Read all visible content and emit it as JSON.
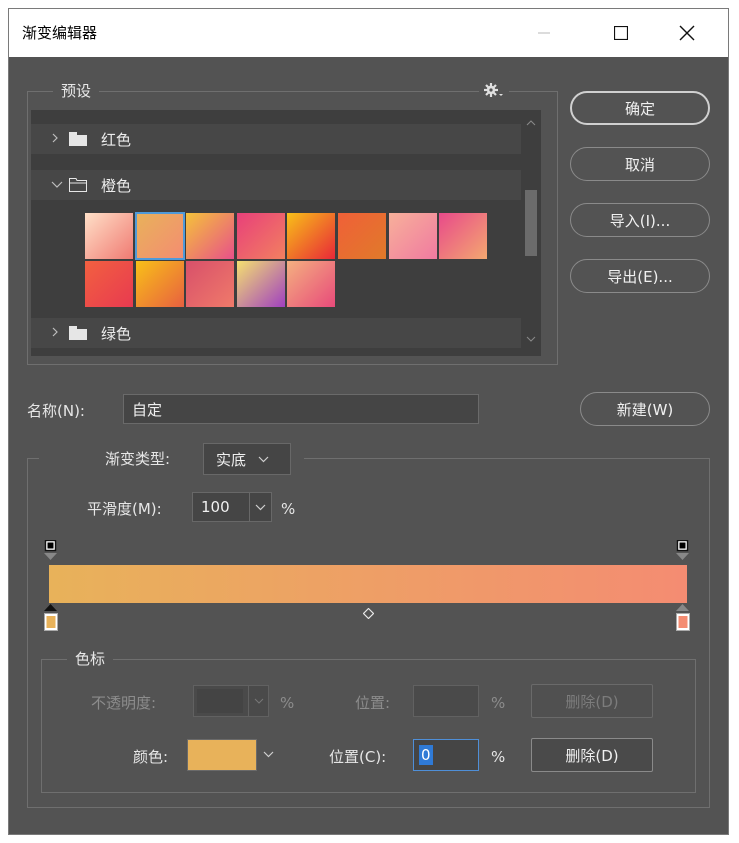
{
  "window": {
    "title": "渐变编辑器"
  },
  "titlebar": {
    "minimize": "—",
    "maximize": "☐",
    "close": "✕"
  },
  "presets": {
    "legend": "预设",
    "folders": [
      {
        "name": "红色",
        "expanded": false
      },
      {
        "name": "橙色",
        "expanded": true
      },
      {
        "name": "绿色",
        "expanded": false
      }
    ],
    "swatches": [
      [
        "#ffe0c8",
        "#f07a72"
      ],
      [
        "#e8b25a",
        "#f48c72"
      ],
      [
        "#f4c23a",
        "#e8508a"
      ],
      [
        "#e8407a",
        "#f28060"
      ],
      [
        "#f8c018",
        "#e82838"
      ],
      [
        "#f06038",
        "#e07a2a"
      ],
      [
        "#f7b09a",
        "#f07aa0"
      ],
      [
        "#e84a8a",
        "#f4a870"
      ],
      [
        "#f26040",
        "#e83a50"
      ],
      [
        "#f8c018",
        "#e86040"
      ],
      [
        "#d8506a",
        "#f07a6a"
      ],
      [
        "#f4e070",
        "#a040c0"
      ],
      [
        "#f4b080",
        "#e84a7a"
      ]
    ],
    "selected_swatch": 1
  },
  "buttons": {
    "ok": "确定",
    "cancel": "取消",
    "import": "导入(I)...",
    "export": "导出(E)...",
    "new": "新建(W)"
  },
  "name_field": {
    "label": "名称(N):",
    "value": "自定"
  },
  "gradient": {
    "type_label": "渐变类型:",
    "type_value": "实底",
    "smoothness_label": "平滑度(M):",
    "smoothness_value": "100",
    "smoothness_unit": "%",
    "colors": {
      "left": "#e8b25a",
      "right": "#f48c72"
    }
  },
  "color_stops": {
    "legend": "色标",
    "opacity_label": "不透明度:",
    "opacity_unit": "%",
    "opacity_position_label": "位置:",
    "opacity_position_unit": "%",
    "opacity_delete": "删除(D)",
    "color_label": "颜色:",
    "color_value": "#e8b25a",
    "color_position_label": "位置(C):",
    "color_position_value": "0",
    "color_position_unit": "%",
    "color_delete": "删除(D)"
  }
}
